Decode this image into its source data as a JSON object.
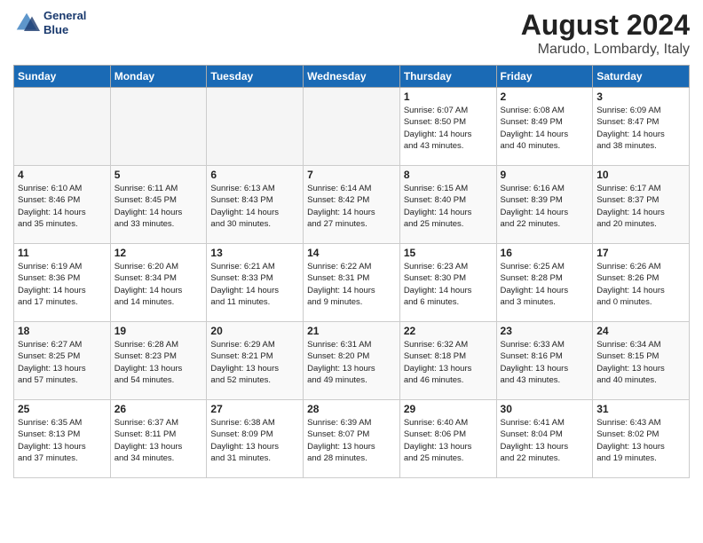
{
  "header": {
    "logo_line1": "General",
    "logo_line2": "Blue",
    "title": "August 2024",
    "subtitle": "Marudo, Lombardy, Italy"
  },
  "days_of_week": [
    "Sunday",
    "Monday",
    "Tuesday",
    "Wednesday",
    "Thursday",
    "Friday",
    "Saturday"
  ],
  "weeks": [
    [
      {
        "num": "",
        "info": "",
        "empty": true
      },
      {
        "num": "",
        "info": "",
        "empty": true
      },
      {
        "num": "",
        "info": "",
        "empty": true
      },
      {
        "num": "",
        "info": "",
        "empty": true
      },
      {
        "num": "1",
        "info": "Sunrise: 6:07 AM\nSunset: 8:50 PM\nDaylight: 14 hours\nand 43 minutes."
      },
      {
        "num": "2",
        "info": "Sunrise: 6:08 AM\nSunset: 8:49 PM\nDaylight: 14 hours\nand 40 minutes."
      },
      {
        "num": "3",
        "info": "Sunrise: 6:09 AM\nSunset: 8:47 PM\nDaylight: 14 hours\nand 38 minutes."
      }
    ],
    [
      {
        "num": "4",
        "info": "Sunrise: 6:10 AM\nSunset: 8:46 PM\nDaylight: 14 hours\nand 35 minutes."
      },
      {
        "num": "5",
        "info": "Sunrise: 6:11 AM\nSunset: 8:45 PM\nDaylight: 14 hours\nand 33 minutes."
      },
      {
        "num": "6",
        "info": "Sunrise: 6:13 AM\nSunset: 8:43 PM\nDaylight: 14 hours\nand 30 minutes."
      },
      {
        "num": "7",
        "info": "Sunrise: 6:14 AM\nSunset: 8:42 PM\nDaylight: 14 hours\nand 27 minutes."
      },
      {
        "num": "8",
        "info": "Sunrise: 6:15 AM\nSunset: 8:40 PM\nDaylight: 14 hours\nand 25 minutes."
      },
      {
        "num": "9",
        "info": "Sunrise: 6:16 AM\nSunset: 8:39 PM\nDaylight: 14 hours\nand 22 minutes."
      },
      {
        "num": "10",
        "info": "Sunrise: 6:17 AM\nSunset: 8:37 PM\nDaylight: 14 hours\nand 20 minutes."
      }
    ],
    [
      {
        "num": "11",
        "info": "Sunrise: 6:19 AM\nSunset: 8:36 PM\nDaylight: 14 hours\nand 17 minutes."
      },
      {
        "num": "12",
        "info": "Sunrise: 6:20 AM\nSunset: 8:34 PM\nDaylight: 14 hours\nand 14 minutes."
      },
      {
        "num": "13",
        "info": "Sunrise: 6:21 AM\nSunset: 8:33 PM\nDaylight: 14 hours\nand 11 minutes."
      },
      {
        "num": "14",
        "info": "Sunrise: 6:22 AM\nSunset: 8:31 PM\nDaylight: 14 hours\nand 9 minutes."
      },
      {
        "num": "15",
        "info": "Sunrise: 6:23 AM\nSunset: 8:30 PM\nDaylight: 14 hours\nand 6 minutes."
      },
      {
        "num": "16",
        "info": "Sunrise: 6:25 AM\nSunset: 8:28 PM\nDaylight: 14 hours\nand 3 minutes."
      },
      {
        "num": "17",
        "info": "Sunrise: 6:26 AM\nSunset: 8:26 PM\nDaylight: 14 hours\nand 0 minutes."
      }
    ],
    [
      {
        "num": "18",
        "info": "Sunrise: 6:27 AM\nSunset: 8:25 PM\nDaylight: 13 hours\nand 57 minutes."
      },
      {
        "num": "19",
        "info": "Sunrise: 6:28 AM\nSunset: 8:23 PM\nDaylight: 13 hours\nand 54 minutes."
      },
      {
        "num": "20",
        "info": "Sunrise: 6:29 AM\nSunset: 8:21 PM\nDaylight: 13 hours\nand 52 minutes."
      },
      {
        "num": "21",
        "info": "Sunrise: 6:31 AM\nSunset: 8:20 PM\nDaylight: 13 hours\nand 49 minutes."
      },
      {
        "num": "22",
        "info": "Sunrise: 6:32 AM\nSunset: 8:18 PM\nDaylight: 13 hours\nand 46 minutes."
      },
      {
        "num": "23",
        "info": "Sunrise: 6:33 AM\nSunset: 8:16 PM\nDaylight: 13 hours\nand 43 minutes."
      },
      {
        "num": "24",
        "info": "Sunrise: 6:34 AM\nSunset: 8:15 PM\nDaylight: 13 hours\nand 40 minutes."
      }
    ],
    [
      {
        "num": "25",
        "info": "Sunrise: 6:35 AM\nSunset: 8:13 PM\nDaylight: 13 hours\nand 37 minutes."
      },
      {
        "num": "26",
        "info": "Sunrise: 6:37 AM\nSunset: 8:11 PM\nDaylight: 13 hours\nand 34 minutes."
      },
      {
        "num": "27",
        "info": "Sunrise: 6:38 AM\nSunset: 8:09 PM\nDaylight: 13 hours\nand 31 minutes."
      },
      {
        "num": "28",
        "info": "Sunrise: 6:39 AM\nSunset: 8:07 PM\nDaylight: 13 hours\nand 28 minutes."
      },
      {
        "num": "29",
        "info": "Sunrise: 6:40 AM\nSunset: 8:06 PM\nDaylight: 13 hours\nand 25 minutes."
      },
      {
        "num": "30",
        "info": "Sunrise: 6:41 AM\nSunset: 8:04 PM\nDaylight: 13 hours\nand 22 minutes."
      },
      {
        "num": "31",
        "info": "Sunrise: 6:43 AM\nSunset: 8:02 PM\nDaylight: 13 hours\nand 19 minutes."
      }
    ]
  ]
}
